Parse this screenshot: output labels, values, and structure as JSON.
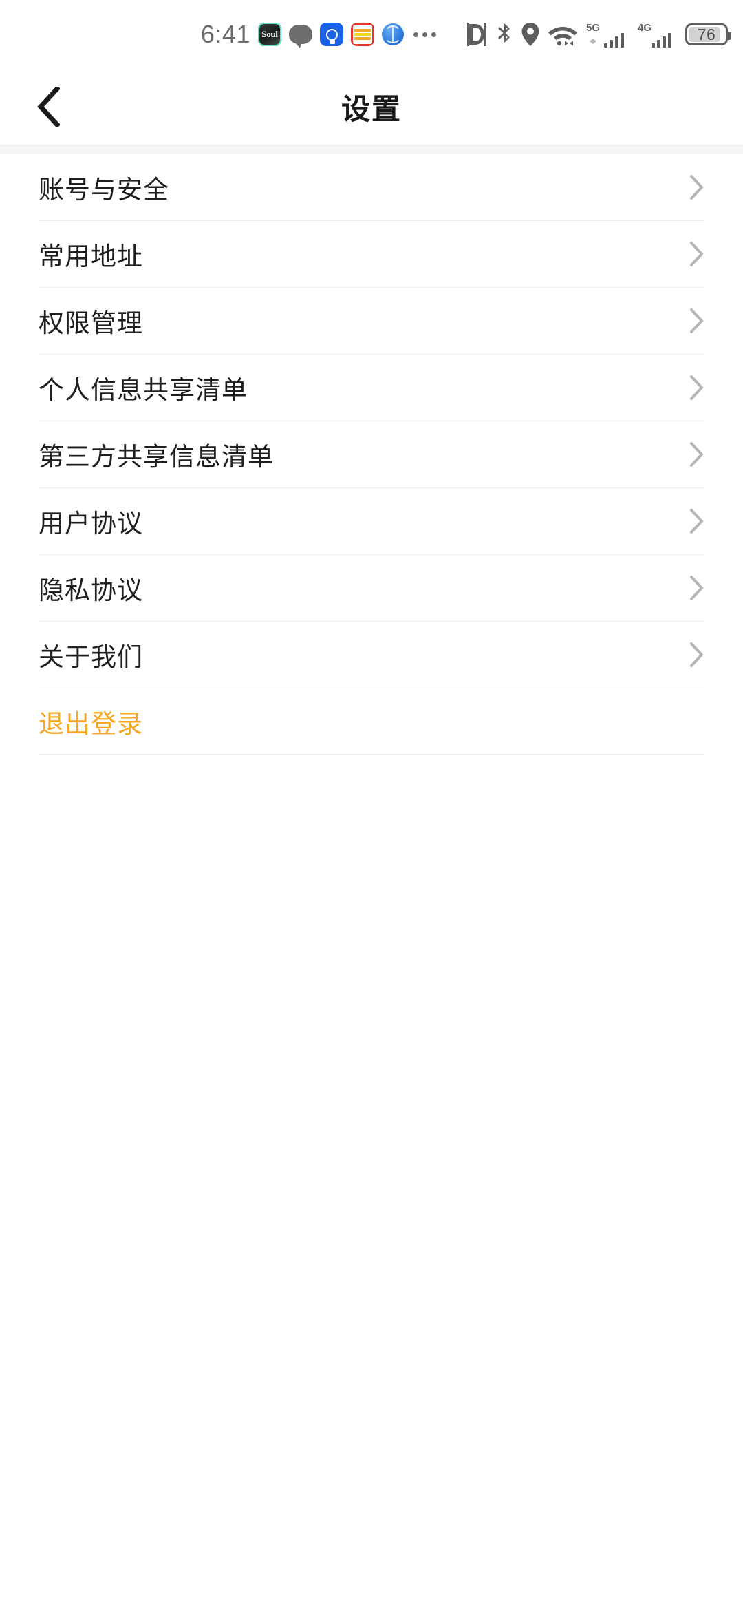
{
  "status_bar": {
    "time": "6:41",
    "notification_icons": [
      {
        "name": "soul-app-icon",
        "label": "Soul"
      },
      {
        "name": "message-bubble-icon",
        "label": ""
      },
      {
        "name": "lightbulb-app-icon",
        "label": ""
      },
      {
        "name": "news-app-icon",
        "label": ""
      },
      {
        "name": "browser-globe-icon",
        "label": ""
      },
      {
        "name": "more-notifications-icon",
        "label": "•••"
      }
    ],
    "system_icons": [
      {
        "name": "nfc-icon"
      },
      {
        "name": "bluetooth-icon"
      },
      {
        "name": "location-icon"
      },
      {
        "name": "wifi-icon"
      },
      {
        "name": "signal-5g-icon",
        "label": "5G"
      },
      {
        "name": "signal-4g-icon",
        "label": "4G"
      }
    ],
    "battery_level": "76"
  },
  "header": {
    "title": "设置",
    "back_label": "‹"
  },
  "menu": {
    "items": [
      {
        "label": "账号与安全"
      },
      {
        "label": "常用地址"
      },
      {
        "label": "权限管理"
      },
      {
        "label": "个人信息共享清单"
      },
      {
        "label": "第三方共享信息清单"
      },
      {
        "label": "用户协议"
      },
      {
        "label": "隐私协议"
      },
      {
        "label": "关于我们"
      }
    ],
    "logout": {
      "label": "退出登录",
      "color": "#F5A623"
    }
  }
}
